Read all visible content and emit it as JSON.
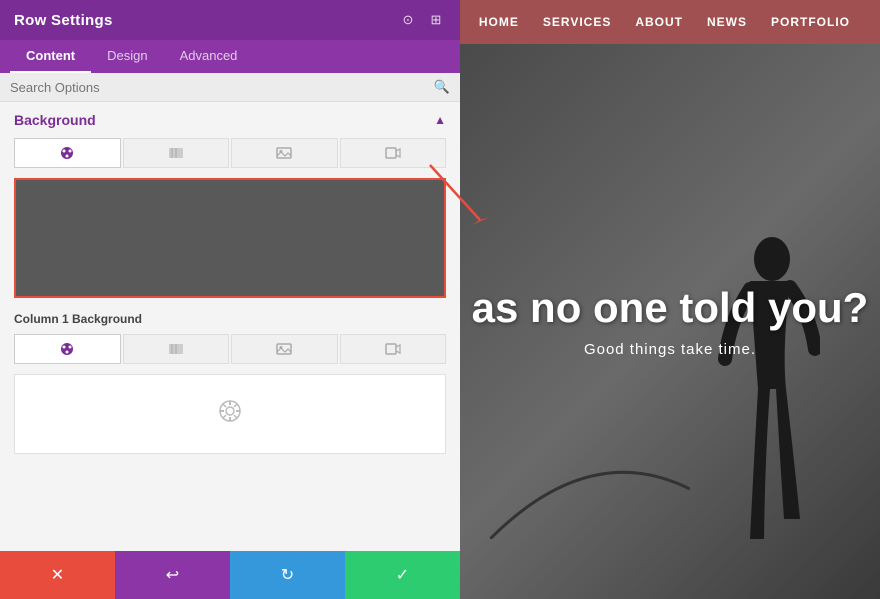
{
  "panel": {
    "title": "Row Settings",
    "header_icons": [
      "focus-icon",
      "expand-icon"
    ],
    "tabs": [
      {
        "label": "Content",
        "active": true
      },
      {
        "label": "Design",
        "active": false
      },
      {
        "label": "Advanced",
        "active": false
      }
    ],
    "search_placeholder": "Search Options"
  },
  "background_section": {
    "title": "Background",
    "bg_types": [
      {
        "name": "color-type-btn",
        "icon": "🎨",
        "active": true
      },
      {
        "name": "gradient-type-btn",
        "icon": "🖼",
        "active": false
      },
      {
        "name": "image-type-btn",
        "icon": "🌅",
        "active": false
      },
      {
        "name": "video-type-btn",
        "icon": "🎬",
        "active": false
      }
    ],
    "color_preview_bg": "#595959"
  },
  "column_section": {
    "title": "Column 1 Background",
    "bg_types": [
      {
        "name": "col-color-type-btn",
        "icon": "🎨",
        "active": true
      },
      {
        "name": "col-gradient-type-btn",
        "icon": "🖼",
        "active": false
      },
      {
        "name": "col-image-type-btn",
        "icon": "🌅",
        "active": false
      },
      {
        "name": "col-video-type-btn",
        "icon": "🎬",
        "active": false
      }
    ]
  },
  "action_bar": {
    "cancel_label": "✕",
    "reset_label": "↩",
    "redo_label": "↻",
    "save_label": "✓"
  },
  "site": {
    "nav_items": [
      "HOME",
      "SERVICES",
      "ABOUT",
      "NEWS",
      "PORTFOLIO"
    ],
    "hero_headline": "as no one told you?",
    "hero_subtext": "Good things take time."
  }
}
